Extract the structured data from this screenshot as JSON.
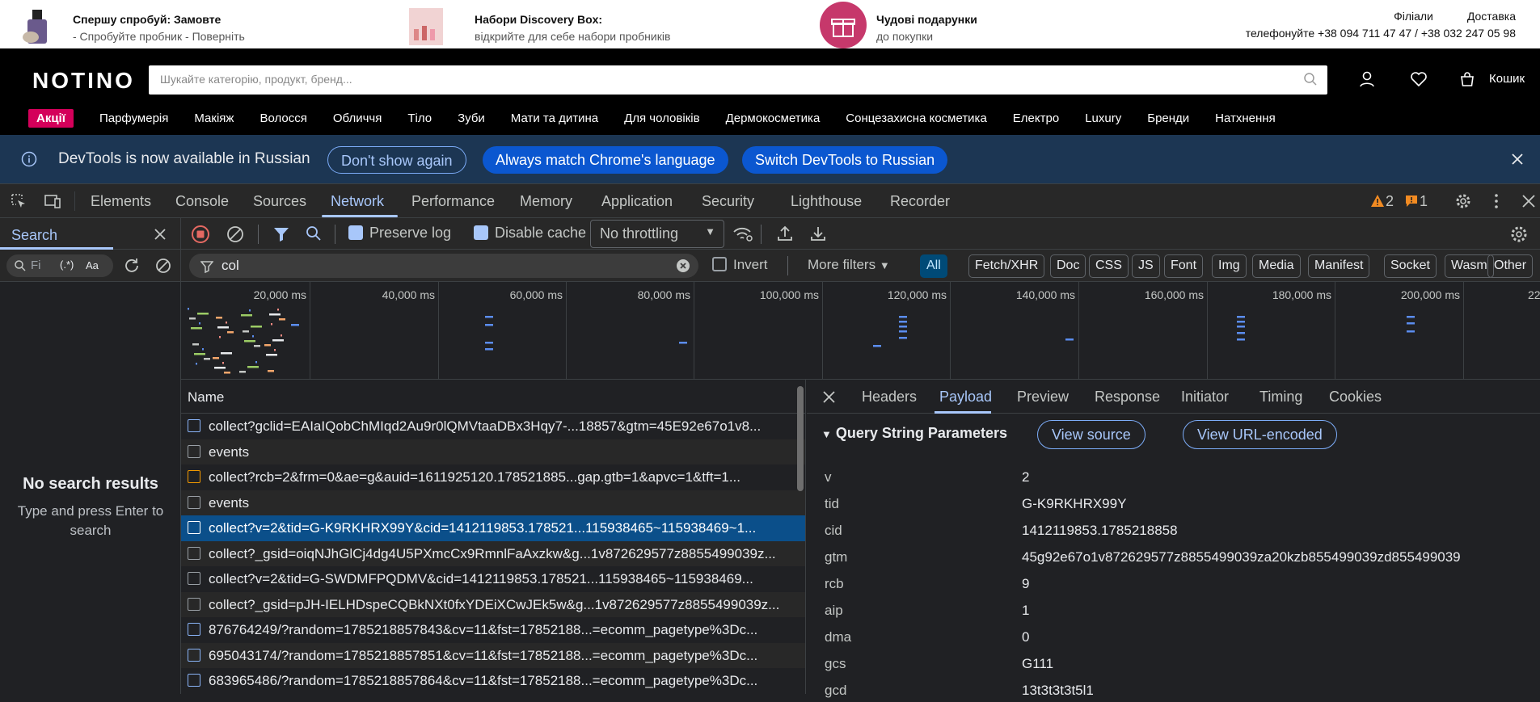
{
  "promo": {
    "item1": {
      "title": "Спершу спробуй: Замовте",
      "sub": "- Спробуйте пробник - Поверніть"
    },
    "item2": {
      "title": "Набори Discovery Box:",
      "sub": "відкрийте для себе набори пробників"
    },
    "item3": {
      "title": "Чудові подарунки",
      "sub": "до покупки"
    },
    "links": [
      "Філіали",
      "Доставка"
    ],
    "phones": "телефонуйте +38 094 711 47 47 / +38 032 247 05 98"
  },
  "header": {
    "logo": "NOTINO",
    "search_placeholder": "Шукайте категорію, продукт, бренд...",
    "cart": "Кошик",
    "sale_label": "Акції",
    "categories": [
      "Парфумерія",
      "Макіяж",
      "Волосся",
      "Обличчя",
      "Тіло",
      "Зуби",
      "Мати та дитина",
      "Для чоловіків",
      "Дермокосметика",
      "Сонцезахисна косметика",
      "Електро",
      "Luxury",
      "Бренди",
      "Натхнення"
    ]
  },
  "banner": {
    "message": "DevTools is now available in Russian",
    "btn_dont_show": "Don't show again",
    "btn_match": "Always match Chrome's language",
    "btn_switch": "Switch DevTools to Russian"
  },
  "tabs": [
    "Elements",
    "Console",
    "Sources",
    "Network",
    "Performance",
    "Memory",
    "Application",
    "Security",
    "Lighthouse",
    "Recorder"
  ],
  "active_tab": "Network",
  "warnings": {
    "warn_count": "2",
    "issue_count": "1"
  },
  "toolbar": {
    "preserve_log": "Preserve log",
    "disable_cache": "Disable cache",
    "throttling": "No throttling"
  },
  "filter": {
    "value": "col",
    "invert": "Invert",
    "more_filters": "More filters",
    "types": [
      "All",
      "Fetch/XHR",
      "Doc",
      "CSS",
      "JS",
      "Font",
      "Img",
      "Media",
      "Manifest",
      "Socket",
      "Wasm",
      "Other"
    ]
  },
  "search_panel": {
    "title": "Search",
    "input_placeholder": "Fi",
    "regex": "(.*)",
    "case": "Aa",
    "empty_title": "No search results",
    "empty_hint": "Type and press Enter to search"
  },
  "overview": {
    "labels": [
      "20,000 ms",
      "40,000 ms",
      "60,000 ms",
      "80,000 ms",
      "100,000 ms",
      "120,000 ms",
      "140,000 ms",
      "160,000 ms",
      "180,000 ms",
      "200,000 ms",
      "22"
    ]
  },
  "request_list": {
    "header": "Name",
    "rows": [
      {
        "name": "collect?gclid=EAIaIQobChMIqd2Au9r0lQMVtaaDBx3Hqy7-...18857&gtm=45E92e67o1v8...",
        "icon": "doc-icon"
      },
      {
        "name": "events",
        "icon": "blank-icon"
      },
      {
        "name": "collect?rcb=2&frm=0&ae=g&auid=1611925120.178521885...gap.gtb=1&apvc=1&tft=1...",
        "icon": "script-icon"
      },
      {
        "name": "events",
        "icon": "file-icon"
      },
      {
        "name": "collect?v=2&tid=G-K9RKHRX99Y&cid=1412119853.178521...115938465~115938469~1...",
        "icon": "blank-icon"
      },
      {
        "name": "collect?_gsid=oiqNJhGlCj4dg4U5PXmcCx9RmnlFaAxzkw&g...1v872629577z8855499039z...",
        "icon": "blank-icon"
      },
      {
        "name": "collect?v=2&tid=G-SWDMFPQDMV&cid=1412119853.178521...115938465~115938469...",
        "icon": "blank-icon"
      },
      {
        "name": "collect?_gsid=pJH-IELHDspeCQBkNXt0fxYDEiXCwJEk5w&g...1v872629577z8855499039z...",
        "icon": "blank-icon"
      },
      {
        "name": "876764249/?random=1785218857843&cv=11&fst=17852188...=ecomm_pagetype%3Dc...",
        "icon": "doc-icon"
      },
      {
        "name": "695043174/?random=1785218857851&cv=11&fst=17852188...=ecomm_pagetype%3Dc...",
        "icon": "doc-icon"
      },
      {
        "name": "683965486/?random=1785218857864&cv=11&fst=17852188...=ecomm_pagetype%3Dc...",
        "icon": "doc-icon"
      }
    ]
  },
  "details": {
    "tabs": [
      "Headers",
      "Payload",
      "Preview",
      "Response",
      "Initiator",
      "Timing",
      "Cookies"
    ],
    "active": "Payload",
    "section": "Query String Parameters",
    "view_source": "View source",
    "view_url_encoded": "View URL-encoded",
    "params": [
      {
        "key": "v",
        "value": "2"
      },
      {
        "key": "tid",
        "value": "G-K9RKHRX99Y"
      },
      {
        "key": "cid",
        "value": "1412119853.1785218858"
      },
      {
        "key": "gtm",
        "value": "45g92e67o1v872629577z8855499039za20kzb855499039zd855499039"
      },
      {
        "key": "rcb",
        "value": "9"
      },
      {
        "key": "aip",
        "value": "1"
      },
      {
        "key": "dma",
        "value": "0"
      },
      {
        "key": "gcs",
        "value": "G111"
      },
      {
        "key": "gcd",
        "value": "13t3t3t3t5l1"
      }
    ]
  },
  "colors": {
    "accent": "#a8c7fa",
    "selected_row": "#0b4f8a",
    "banner_bg": "#1c3653",
    "sale": "#d4005a"
  }
}
